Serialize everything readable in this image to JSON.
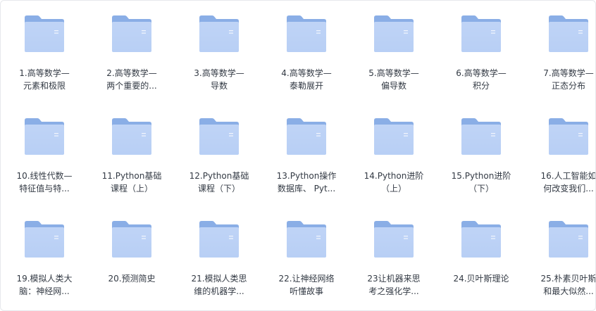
{
  "folder_icon": "folder-icon",
  "colors": {
    "folder_back": "#8aaee6",
    "folder_front": "#b8cff5",
    "text": "#333a44"
  },
  "folders": [
    {
      "line1": "1.高等数学—",
      "line2": "元素和极限"
    },
    {
      "line1": "2.高等数学—",
      "line2": "两个重要的..."
    },
    {
      "line1": "3.高等数学—",
      "line2": "导数"
    },
    {
      "line1": "4.高等数学—",
      "line2": "泰勒展开"
    },
    {
      "line1": "5.高等数学—",
      "line2": "偏导数"
    },
    {
      "line1": "6.高等数学—",
      "line2": "积分"
    },
    {
      "line1": "7.高等数学—",
      "line2": "正态分布"
    },
    {
      "line1": "10.线性代数—",
      "line2": "特征值与特..."
    },
    {
      "line1": "11.Python基础",
      "line2": "课程（上）"
    },
    {
      "line1": "12.Python基础",
      "line2": "课程（下）"
    },
    {
      "line1": "13.Python操作",
      "line2": "数据库、 Pyt..."
    },
    {
      "line1": "14.Python进阶",
      "line2": "（上）"
    },
    {
      "line1": "15.Python进阶",
      "line2": "（下）"
    },
    {
      "line1": "16.人工智能如",
      "line2": "何改变我们..."
    },
    {
      "line1": "19.模拟人类大",
      "line2": "脑：神经网..."
    },
    {
      "line1": "20.预测简史",
      "line2": ""
    },
    {
      "line1": "21.模拟人类思",
      "line2": "维的机器学..."
    },
    {
      "line1": "22.让神经网络",
      "line2": "听懂故事"
    },
    {
      "line1": "23让机器来思",
      "line2": "考之强化学..."
    },
    {
      "line1": "24.贝叶斯理论",
      "line2": ""
    },
    {
      "line1": "25.朴素贝叶斯",
      "line2": "和最大似然..."
    }
  ]
}
